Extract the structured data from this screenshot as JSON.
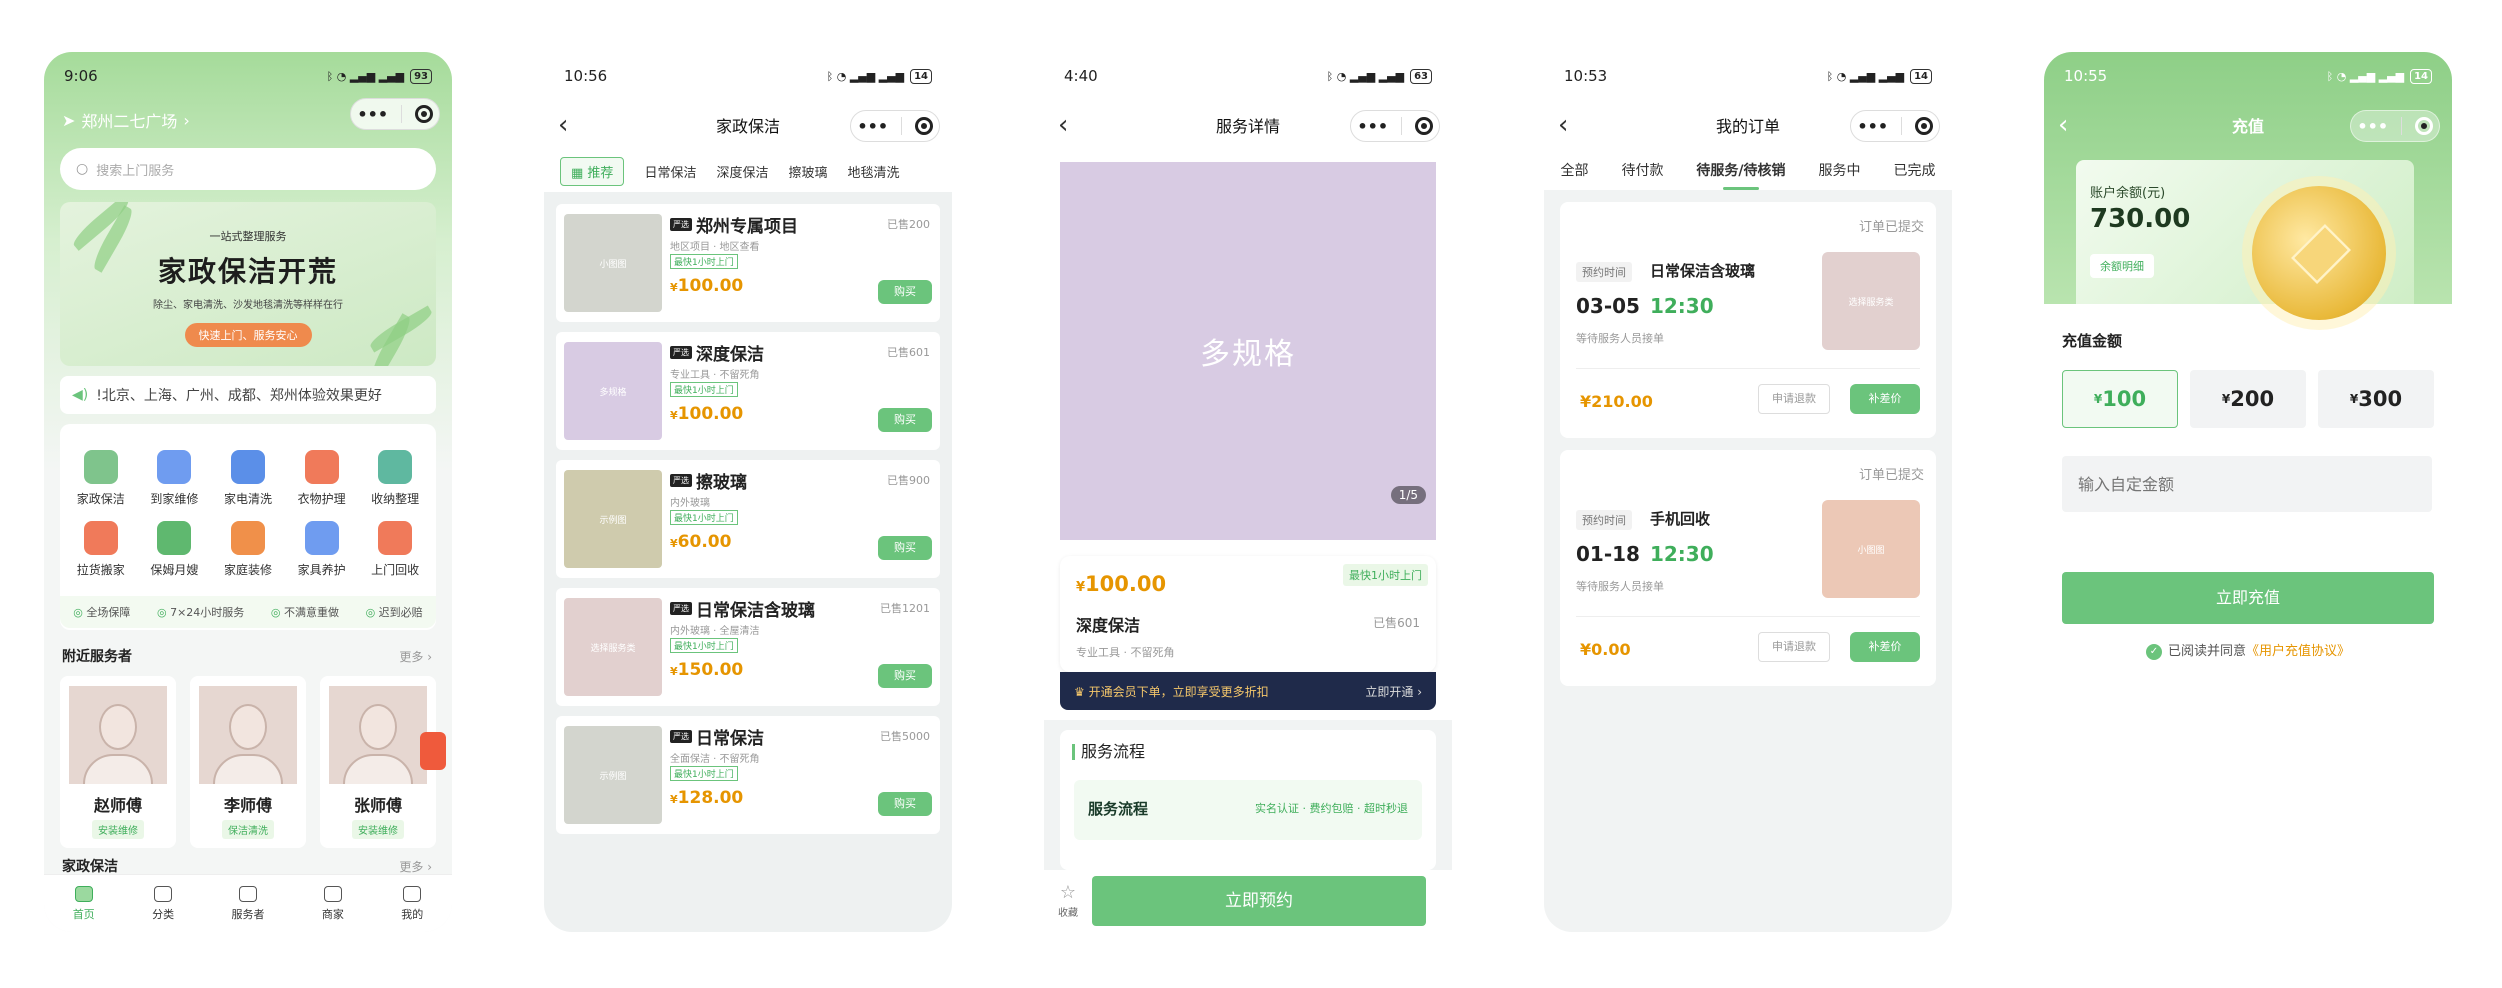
{
  "p1": {
    "status_time": "9:06",
    "battery": "93",
    "location": "郑州二七广场",
    "search_placeholder": "搜索上门服务",
    "banner": {
      "kicker": "一站式整理服务",
      "title": "家政保洁开荒",
      "subtitle": "除尘、家电清洗、沙发地毯清洗等样样在行",
      "cta": "快速上门、服务安心"
    },
    "notice": "!北京、上海、广州、成都、郑州体验效果更好",
    "categories": [
      {
        "label": "家政保洁",
        "icon": "house-icon",
        "color": "#7fc48c"
      },
      {
        "label": "到家维修",
        "icon": "toolbox-icon",
        "color": "#6f9cf0"
      },
      {
        "label": "家电清洗",
        "icon": "washer-icon",
        "color": "#5b8fe8"
      },
      {
        "label": "衣物护理",
        "icon": "shirt-icon",
        "color": "#f07a5a"
      },
      {
        "label": "收纳整理",
        "icon": "storage-box-icon",
        "color": "#5fb8a0"
      },
      {
        "label": "拉货搬家",
        "icon": "truck-icon",
        "color": "#f07a5a"
      },
      {
        "label": "保姆月嫂",
        "icon": "baby-bottle-icon",
        "color": "#5fb86f"
      },
      {
        "label": "家庭装修",
        "icon": "paint-kit-icon",
        "color": "#f0904a"
      },
      {
        "label": "家具养护",
        "icon": "sofa-icon",
        "color": "#6f9cf0"
      },
      {
        "label": "上门回收",
        "icon": "recycle-bag-icon",
        "color": "#f07a5a"
      }
    ],
    "guarantees": [
      "全场保障",
      "7×24小时服务",
      "不满意重做",
      "迟到必赔"
    ],
    "nearby_title": "附近服务者",
    "more": "更多",
    "workers": [
      {
        "name": "赵师傅",
        "tag": "安装维修"
      },
      {
        "name": "李师傅",
        "tag": "保洁清洗"
      },
      {
        "name": "张师傅",
        "tag": "安装维修"
      }
    ],
    "section2_title": "家政保洁",
    "more2": "更多",
    "tabs": [
      "首页",
      "分类",
      "服务者",
      "商家",
      "我的"
    ]
  },
  "p2": {
    "status_time": "10:56",
    "battery": "14",
    "title": "家政保洁",
    "filters": [
      "推荐",
      "日常保洁",
      "深度保洁",
      "擦玻璃",
      "地毯清洗"
    ],
    "badge": "严选",
    "fast": "最快1小时上门",
    "buy": "购买",
    "currency": "¥",
    "items": [
      {
        "name": "郑州专属项目",
        "sold": "已售200",
        "desc": "地区项目 · 地区查看",
        "price": "100.00",
        "thumb_color": "#d3d5ce",
        "thumb_text": "小图图"
      },
      {
        "name": "深度保洁",
        "sold": "已售601",
        "desc": "专业工具 · 不留死角",
        "price": "100.00",
        "thumb_color": "#d8cbe3",
        "thumb_text": "多规格"
      },
      {
        "name": "擦玻璃",
        "sold": "已售900",
        "desc": "内外玻璃",
        "price": "60.00",
        "thumb_color": "#cfcbad",
        "thumb_text": "示例图"
      },
      {
        "name": "日常保洁含玻璃",
        "sold": "已售1201",
        "desc": "内外玻璃 · 全屋清洁",
        "price": "150.00",
        "thumb_color": "#e2d0cf",
        "thumb_text": "选择服务类"
      },
      {
        "name": "日常保洁",
        "sold": "已售5000",
        "desc": "全面保洁 · 不留死角",
        "price": "128.00",
        "thumb_color": "#d3d5ce",
        "thumb_text": "示例图"
      }
    ]
  },
  "p3": {
    "status_time": "4:40",
    "battery": "63",
    "title": "服务详情",
    "gallery_text": "多规格",
    "gallery_page": "1/5",
    "currency": "¥",
    "price": "100.00",
    "fast": "最快1小时上门",
    "name": "深度保洁",
    "sold": "已售601",
    "desc": "专业工具 · 不留死角",
    "vip_text": "开通会员下单，立即享受更多折扣",
    "vip_go": "立即开通",
    "flow_heading": "服务流程",
    "flow_box_title": "服务流程",
    "flow_box_steps": "实名认证 · 费约包赔 · 超时秒退",
    "fav": "收藏",
    "book": "立即预约"
  },
  "p4": {
    "status_time": "10:53",
    "battery": "14",
    "title": "我的订单",
    "tabs": [
      "全部",
      "待付款",
      "待服务/待核销",
      "服务中",
      "已完成"
    ],
    "active_tab": 2,
    "time_label": "预约时间",
    "refund": "申请退款",
    "pay_diff": "补差价",
    "currency": "¥",
    "orders": [
      {
        "status": "订单已提交",
        "service": "日常保洁含玻璃",
        "date": "03-05",
        "time": "12:30",
        "wait": "等待服务人员接单",
        "price": "210.00",
        "thumb_color": "#e2d0cf",
        "thumb_text": "选择服务类"
      },
      {
        "status": "订单已提交",
        "service": "手机回收",
        "date": "01-18",
        "time": "12:30",
        "wait": "等待服务人员接单",
        "price": "0.00",
        "thumb_color": "#ecc8b6",
        "thumb_text": "小图图"
      }
    ]
  },
  "p5": {
    "status_time": "10:55",
    "battery": "14",
    "title": "充值",
    "balance_label": "账户余额(元)",
    "balance": "730.00",
    "detail": "余额明细",
    "amount_label": "充值金额",
    "currency": "¥",
    "amounts": [
      "100",
      "200",
      "300"
    ],
    "selected": 0,
    "custom_placeholder": "输入自定金额",
    "submit": "立即充值",
    "agree_prefix": "已阅读并同意",
    "agree_link": "《用户充值协议》"
  }
}
